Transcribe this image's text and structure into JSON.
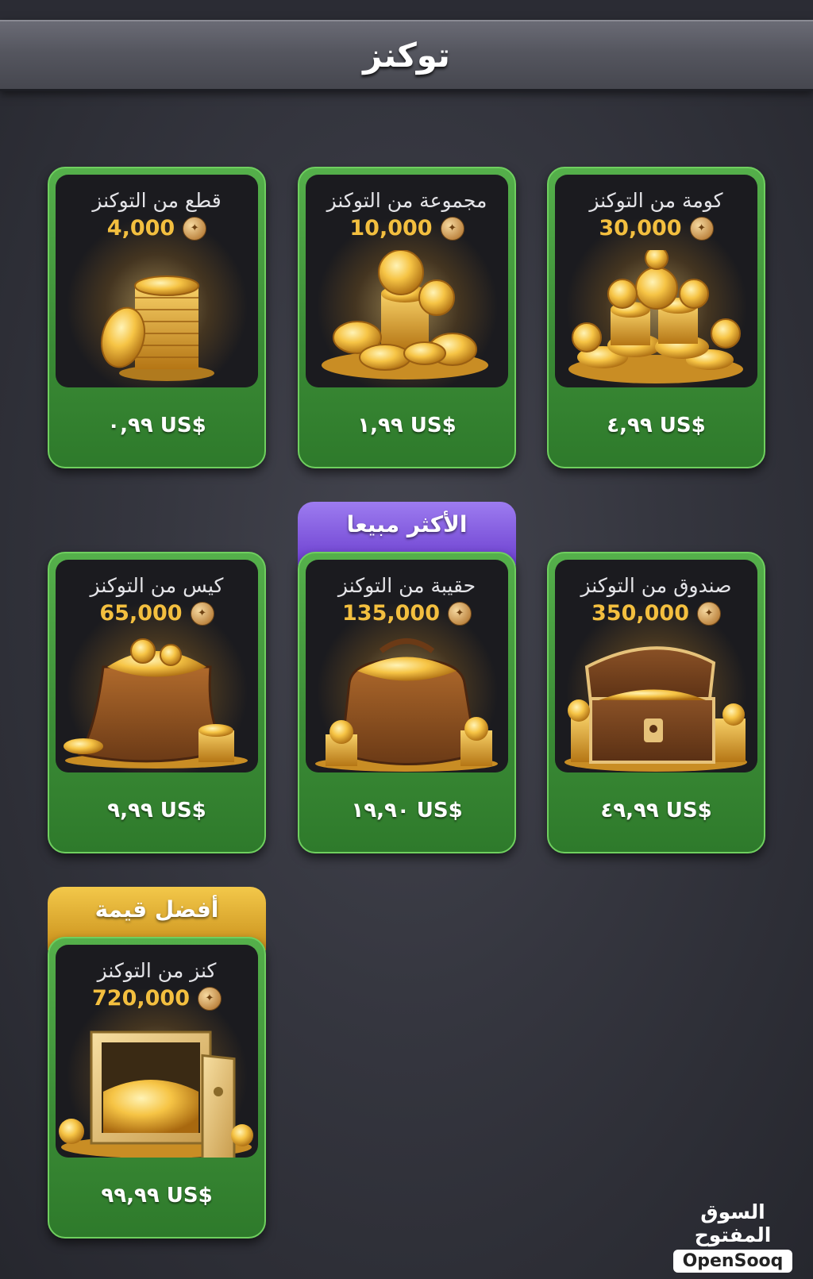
{
  "header": {
    "title": "توكنز"
  },
  "products": [
    {
      "name": "كومة من التوكنز",
      "amount": "30,000",
      "price": "٤,٩٩ US$",
      "art": "coin-heap-art"
    },
    {
      "name": "مجموعة من التوكنز",
      "amount": "10,000",
      "price": "١,٩٩ US$",
      "art": "coin-group-art"
    },
    {
      "name": "قطع من التوكنز",
      "amount": "4,000",
      "price": "٠,٩٩ US$",
      "art": "coin-stack-art"
    },
    {
      "name": "صندوق من التوكنز",
      "amount": "350,000",
      "price": "٤٩,٩٩ US$",
      "art": "treasure-chest-art"
    },
    {
      "name": "حقيبة من التوكنز",
      "amount": "135,000",
      "price": "١٩,٩٠ US$",
      "art": "coin-purse-art"
    },
    {
      "name": "كيس من التوكنز",
      "amount": "65,000",
      "price": "٩,٩٩ US$",
      "art": "coin-sack-art"
    },
    {
      "name": "كنز من التوكنز",
      "amount": "720,000",
      "price": "٩٩,٩٩ US$",
      "art": "coin-safe-art"
    }
  ],
  "badges": {
    "best_seller": "الأكثر مبيعا",
    "best_value": "أفضل قيمة"
  },
  "watermark": {
    "arabic": "السوق المفتوح",
    "english": "OpenSooq"
  },
  "colors": {
    "card_green": "#3f9a3a",
    "price_gold": "#f3bf3f",
    "ribbon_purple": "#7a4fe0",
    "ribbon_gold": "#e0a92a"
  }
}
